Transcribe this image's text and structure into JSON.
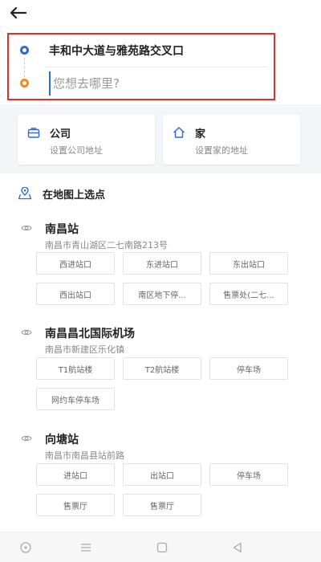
{
  "route": {
    "from": "丰和中大道与雅苑路交叉口",
    "to_placeholder": "您想去哪里?"
  },
  "quick": {
    "company": {
      "title": "公司",
      "subtitle": "设置公司地址",
      "icon": "briefcase-icon"
    },
    "home": {
      "title": "家",
      "subtitle": "设置家的地址",
      "icon": "home-icon"
    }
  },
  "map_pick": {
    "label": "在地图上选点",
    "icon": "map-pin-icon"
  },
  "places": [
    {
      "name": "南昌站",
      "address": "南昌市青山湖区二七南路213号",
      "chips": [
        "西进站口",
        "东进站口",
        "东出站口",
        "西出站口",
        "南区地下停...",
        "售票处(二七..."
      ]
    },
    {
      "name": "南昌昌北国际机场",
      "address": "南昌市新建区乐化镇",
      "chips": [
        "T1航站楼",
        "T2航站楼",
        "停车场",
        "网约车停车场"
      ]
    },
    {
      "name": "向塘站",
      "address": "南昌市南昌县站前路",
      "chips": [
        "进站口",
        "出站口",
        "停车场",
        "售票厅",
        "售票厅"
      ]
    }
  ],
  "colors": {
    "accent": "#2b6bd6",
    "destination": "#f08a24",
    "highlight": "#e0312f"
  }
}
